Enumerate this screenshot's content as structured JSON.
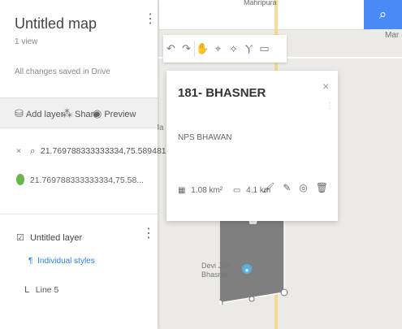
{
  "app": {
    "title": "Untitled map",
    "views": "1 view",
    "save_status": "All changes saved in Drive"
  },
  "actions": {
    "add_layer": "Add layer",
    "share": "Share",
    "preview": "Preview"
  },
  "search": {
    "query": "21.769788333333334,75.589481...",
    "result": "21.769788333333334,75.58..."
  },
  "layer": {
    "title": "Untitled layer",
    "styles": "Individual styles",
    "line_item": "Line 5"
  },
  "map": {
    "top_label": "Mahripura",
    "right_label": "Mar",
    "side_label": "Ja",
    "pin_label": "Devi Jhin Bhasner"
  },
  "info": {
    "title": "181- BHASNER",
    "description": "NPS BHAWAN",
    "area": "1.08 km²",
    "perimeter": "4.1 km"
  },
  "colors": {
    "accent": "#4a8af4",
    "polygon": "#7f7f7f",
    "polygon_stroke": "#ffffff"
  },
  "icons": {
    "search": "search-icon",
    "kebab": "kebab-menu-icon",
    "add_layer": "layers-icon",
    "share": "share-icon",
    "preview": "eye-icon",
    "close": "close-icon",
    "green_pin": "green-pin-icon",
    "polygon": "polygon-icon",
    "checkbox": "checkbox-icon",
    "paint": "paint-icon",
    "line": "line-icon"
  }
}
